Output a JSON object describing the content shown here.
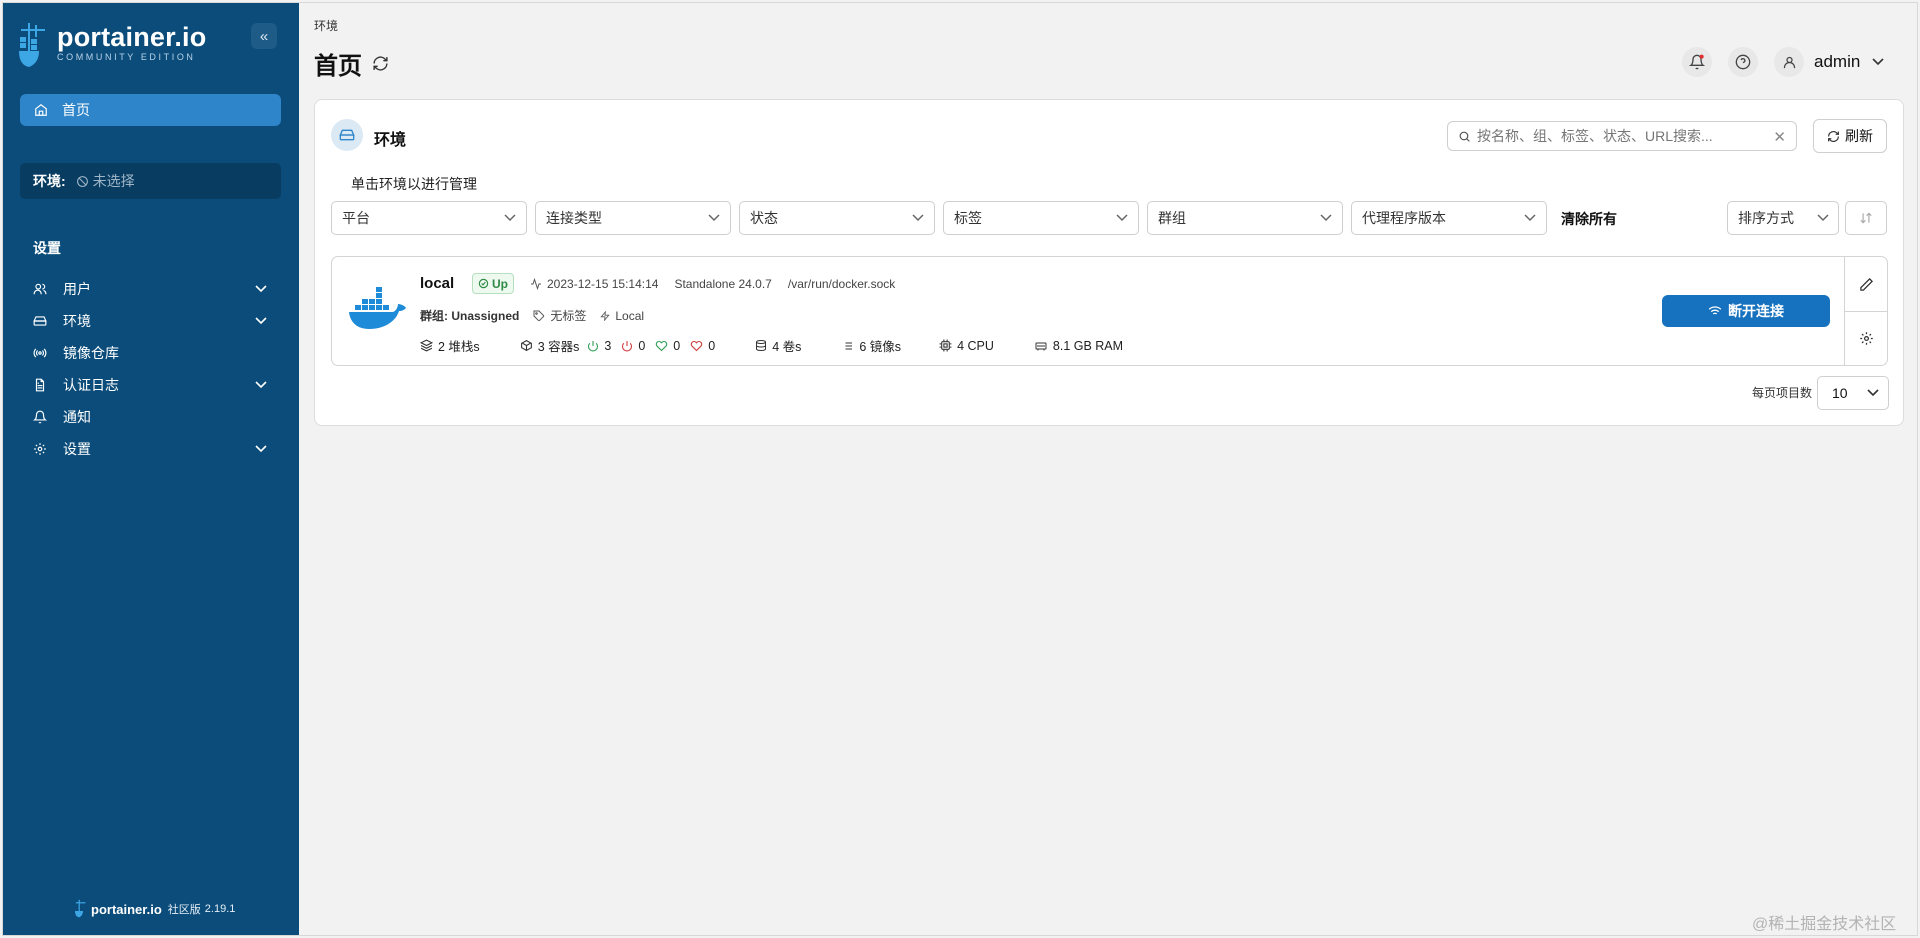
{
  "brand": {
    "name": "portainer.io",
    "edition": "COMMUNITY EDITION",
    "footer_name": "portainer.io",
    "footer_edition": "社区版",
    "version": "2.19.1"
  },
  "sidebar": {
    "home_label": "首页",
    "env_label": "环境:",
    "env_value": "未选择",
    "section_title": "设置",
    "items": [
      {
        "label": "用户",
        "icon": "users-icon",
        "expandable": true
      },
      {
        "label": "环境",
        "icon": "hard-drive-icon",
        "expandable": true
      },
      {
        "label": "镜像仓库",
        "icon": "radio-icon",
        "expandable": false
      },
      {
        "label": "认证日志",
        "icon": "file-text-icon",
        "expandable": true
      },
      {
        "label": "通知",
        "icon": "bell-icon",
        "expandable": false
      },
      {
        "label": "设置",
        "icon": "gear-icon",
        "expandable": true
      }
    ]
  },
  "header": {
    "breadcrumb": "环境",
    "title": "首页",
    "user": "admin"
  },
  "panel": {
    "title": "环境",
    "search_placeholder": "按名称、组、标签、状态、URL搜索...",
    "refresh_label": "刷新",
    "hint": "单击环境以进行管理",
    "filters": [
      "平台",
      "连接类型",
      "状态",
      "标签",
      "群组",
      "代理程序版本"
    ],
    "clear_all": "清除所有",
    "sort_label": "排序方式",
    "per_page_label": "每页项目数",
    "per_page_value": "10"
  },
  "environment": {
    "name": "local",
    "status": "Up",
    "timestamp": "2023-12-15 15:14:14",
    "standalone": "Standalone 24.0.7",
    "socket": "/var/run/docker.sock",
    "group": "群组: Unassigned",
    "tags": "无标签",
    "type": "Local",
    "stacks": "2 堆栈s",
    "containers": "3 容器s",
    "running": "3",
    "stopped": "0",
    "healthy": "0",
    "unhealthy": "0",
    "volumes": "4 卷s",
    "images": "6 镜像s",
    "cpu": "4 CPU",
    "ram": "8.1 GB RAM",
    "action_label": "断开连接"
  },
  "colors": {
    "sidebar": "#0b4c7a",
    "accent": "#2f85c9",
    "primary_button": "#1672be",
    "status_up": "#2f8a44"
  },
  "watermark": "@稀土掘金技术社区"
}
